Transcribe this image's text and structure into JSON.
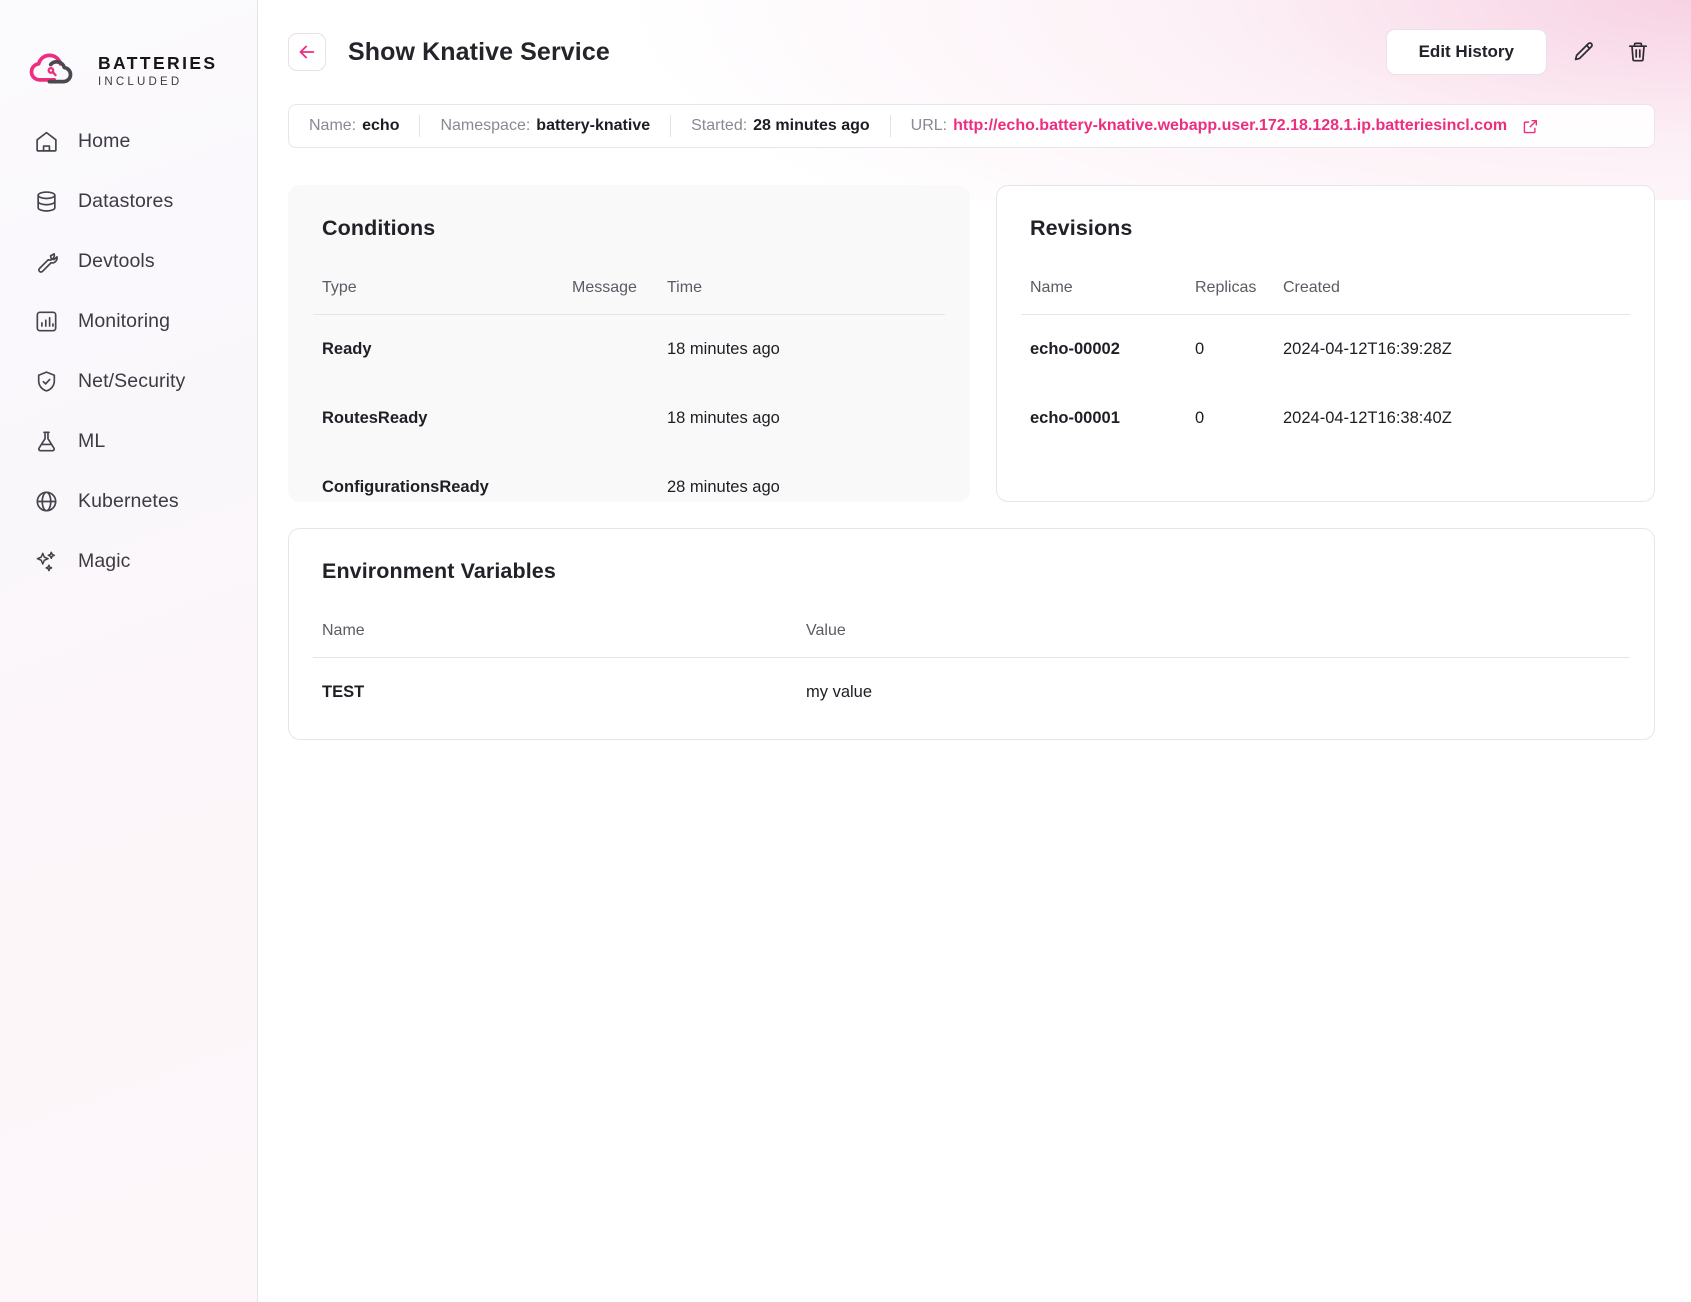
{
  "brand": {
    "line1": "BATTERIES",
    "line2": "INCLUDED",
    "logo_pink": "#ed2e7e",
    "logo_gray": "#4b4950"
  },
  "sidebar": {
    "items": [
      {
        "label": "Home",
        "icon": "home-icon"
      },
      {
        "label": "Datastores",
        "icon": "database-icon"
      },
      {
        "label": "Devtools",
        "icon": "wrench-icon"
      },
      {
        "label": "Monitoring",
        "icon": "chart-bar-icon"
      },
      {
        "label": "Net/Security",
        "icon": "shield-check-icon"
      },
      {
        "label": "ML",
        "icon": "flask-icon"
      },
      {
        "label": "Kubernetes",
        "icon": "globe-icon"
      },
      {
        "label": "Magic",
        "icon": "sparkles-icon"
      }
    ]
  },
  "topbar": {
    "back_icon": "arrow-left-icon",
    "title": "Show Knative Service",
    "edit_history_label": "Edit History",
    "edit_icon": "pencil-icon",
    "delete_icon": "trash-icon",
    "accent": "#ed2e7e"
  },
  "info_bar": {
    "name_key": "Name:",
    "name_value": "echo",
    "namespace_key": "Namespace:",
    "namespace_value": "battery-knative",
    "started_key": "Started:",
    "started_value": "28 minutes ago",
    "url_key": "URL:",
    "url_value": "http://echo.battery-knative.webapp.user.172.18.128.1.ip.batteriesincl.com",
    "external_link_icon": "external-link-icon"
  },
  "conditions": {
    "title": "Conditions",
    "columns": [
      "Type",
      "Message",
      "Time"
    ],
    "rows": [
      {
        "type": "Ready",
        "message": "",
        "time": "18 minutes ago"
      },
      {
        "type": "RoutesReady",
        "message": "",
        "time": "18 minutes ago"
      },
      {
        "type": "ConfigurationsReady",
        "message": "",
        "time": "28 minutes ago"
      }
    ]
  },
  "revisions": {
    "title": "Revisions",
    "columns": [
      "Name",
      "Replicas",
      "Created"
    ],
    "rows": [
      {
        "name": "echo-00002",
        "replicas": "0",
        "created": "2024-04-12T16:39:28Z"
      },
      {
        "name": "echo-00001",
        "replicas": "0",
        "created": "2024-04-12T16:38:40Z"
      }
    ]
  },
  "env_vars": {
    "title": "Environment Variables",
    "columns": [
      "Name",
      "Value"
    ],
    "rows": [
      {
        "name": "TEST",
        "value": "my value"
      }
    ]
  }
}
